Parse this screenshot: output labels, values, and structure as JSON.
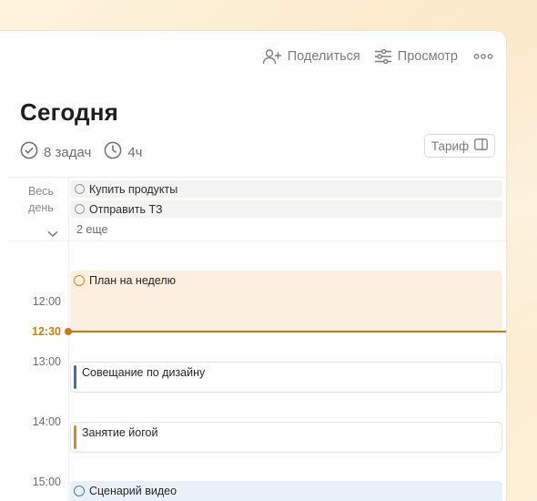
{
  "toolbar": {
    "share_label": "Поделиться",
    "view_label": "Просмотр",
    "share_icon": "person-add-icon",
    "view_icon": "sliders-icon",
    "more_icon": "more-horizontal-icon"
  },
  "header": {
    "title": "Сегодня",
    "tasks_count": "8 задач",
    "time_total": "4ч",
    "tariff_label": "Тариф"
  },
  "all_day": {
    "label_line1": "Весь",
    "label_line2": "день",
    "items": [
      {
        "title": "Купить продукты"
      },
      {
        "title": "Отправить ТЗ"
      }
    ],
    "more_label": "2 еще"
  },
  "timeline": {
    "hours": [
      "12:00",
      "13:00",
      "14:00",
      "15:00"
    ],
    "now": "12:30",
    "events": [
      {
        "title": "План на неделю",
        "color": "#d08a1e"
      },
      {
        "title": "Совещание по дизайну",
        "color": "#3d6fb6"
      },
      {
        "title": "Занятие йогой",
        "color": "#d08a1e"
      },
      {
        "title": "Сценарий видео",
        "color": "#4a78b6"
      }
    ]
  },
  "colors": {
    "accent": "#c87a0e",
    "now_text": "#c8800a",
    "plan_bg": "#fcefe0",
    "video_bg": "#e9f0f9"
  }
}
